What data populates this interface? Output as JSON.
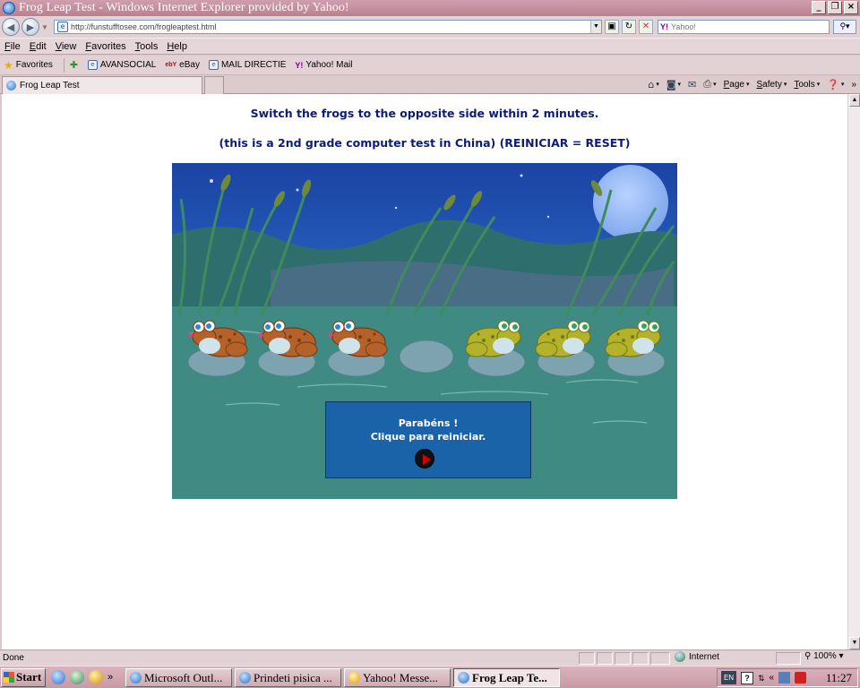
{
  "window": {
    "title": "Frog Leap Test - Windows Internet Explorer provided by Yahoo!",
    "controls": [
      "_",
      "❐",
      "×"
    ]
  },
  "address": {
    "url": "http://funstufftosee.com/frogleaptest.html",
    "search_placeholder": "Yahoo!"
  },
  "menu": [
    "File",
    "Edit",
    "View",
    "Favorites",
    "Tools",
    "Help"
  ],
  "favorites_bar": {
    "label": "Favorites",
    "links": [
      "AVANSOCIAL",
      "eBay",
      "MAIL DIRECTIE",
      "Yahoo! Mail"
    ],
    "ebay_logo": "ebY"
  },
  "tab": {
    "label": "Frog Leap Test"
  },
  "command_bar": {
    "page": "Page",
    "safety": "Safety",
    "tools": "Tools"
  },
  "content": {
    "instruction": "Switch the frogs to the opposite side within 2 minutes.",
    "note": "(this is a 2nd grade computer test in China) (REINICIAR = RESET)",
    "game": {
      "message_line1": "Parabéns !",
      "message_line2": "Clique para reiniciar.",
      "frogs": [
        "brown",
        "brown",
        "brown",
        "empty",
        "green",
        "green",
        "green"
      ],
      "colors": {
        "sky": "#1f4fae",
        "water": "#3f8a82",
        "brown_frog": "#b4622a",
        "green_frog": "#b3b22a",
        "panel": "#1b63a8"
      }
    }
  },
  "status": {
    "left": "Done",
    "zone": "Internet",
    "zoom": "100%"
  },
  "taskbar": {
    "start": "Start",
    "tasks": [
      "Microsoft Outl...",
      "Prindeti pisica ...",
      "Yahoo! Messe...",
      "Frog Leap Te..."
    ],
    "language": "EN",
    "clock": "11:27"
  }
}
